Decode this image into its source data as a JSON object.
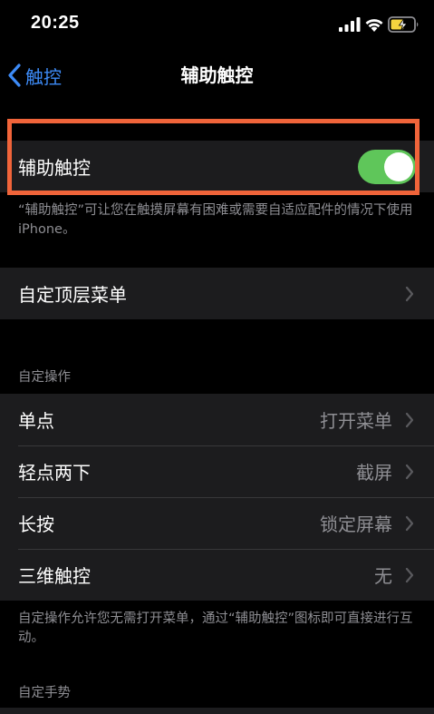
{
  "status_bar": {
    "time": "20:25",
    "icons": [
      "signal-icon",
      "wifi-icon",
      "battery-charging-icon"
    ]
  },
  "nav": {
    "back_label": "触控",
    "title": "辅助触控"
  },
  "assistive_touch": {
    "label": "辅助触控",
    "toggle_on": true,
    "footer": "“辅助触控”可让您在触摸屏幕有困难或需要自适应配件的情况下使用iPhone。"
  },
  "top_menu": {
    "label": "自定顶层菜单"
  },
  "custom_actions": {
    "header": "自定操作",
    "rows": [
      {
        "label": "单点",
        "value": "打开菜单"
      },
      {
        "label": "轻点两下",
        "value": "截屏"
      },
      {
        "label": "长按",
        "value": "锁定屏幕"
      },
      {
        "label": "三维触控",
        "value": "无"
      }
    ],
    "footer": "自定操作允许您无需打开菜单，通过“辅助触控”图标即可直接进行互动。"
  },
  "custom_gestures": {
    "header": "自定手势"
  },
  "colors": {
    "background": "#000000",
    "cell": "#1c1c1e",
    "accent_blue": "#3d8bf7",
    "toggle_green": "#5fc65a",
    "highlight": "#f0643a",
    "secondary_text": "#8e8e93"
  }
}
